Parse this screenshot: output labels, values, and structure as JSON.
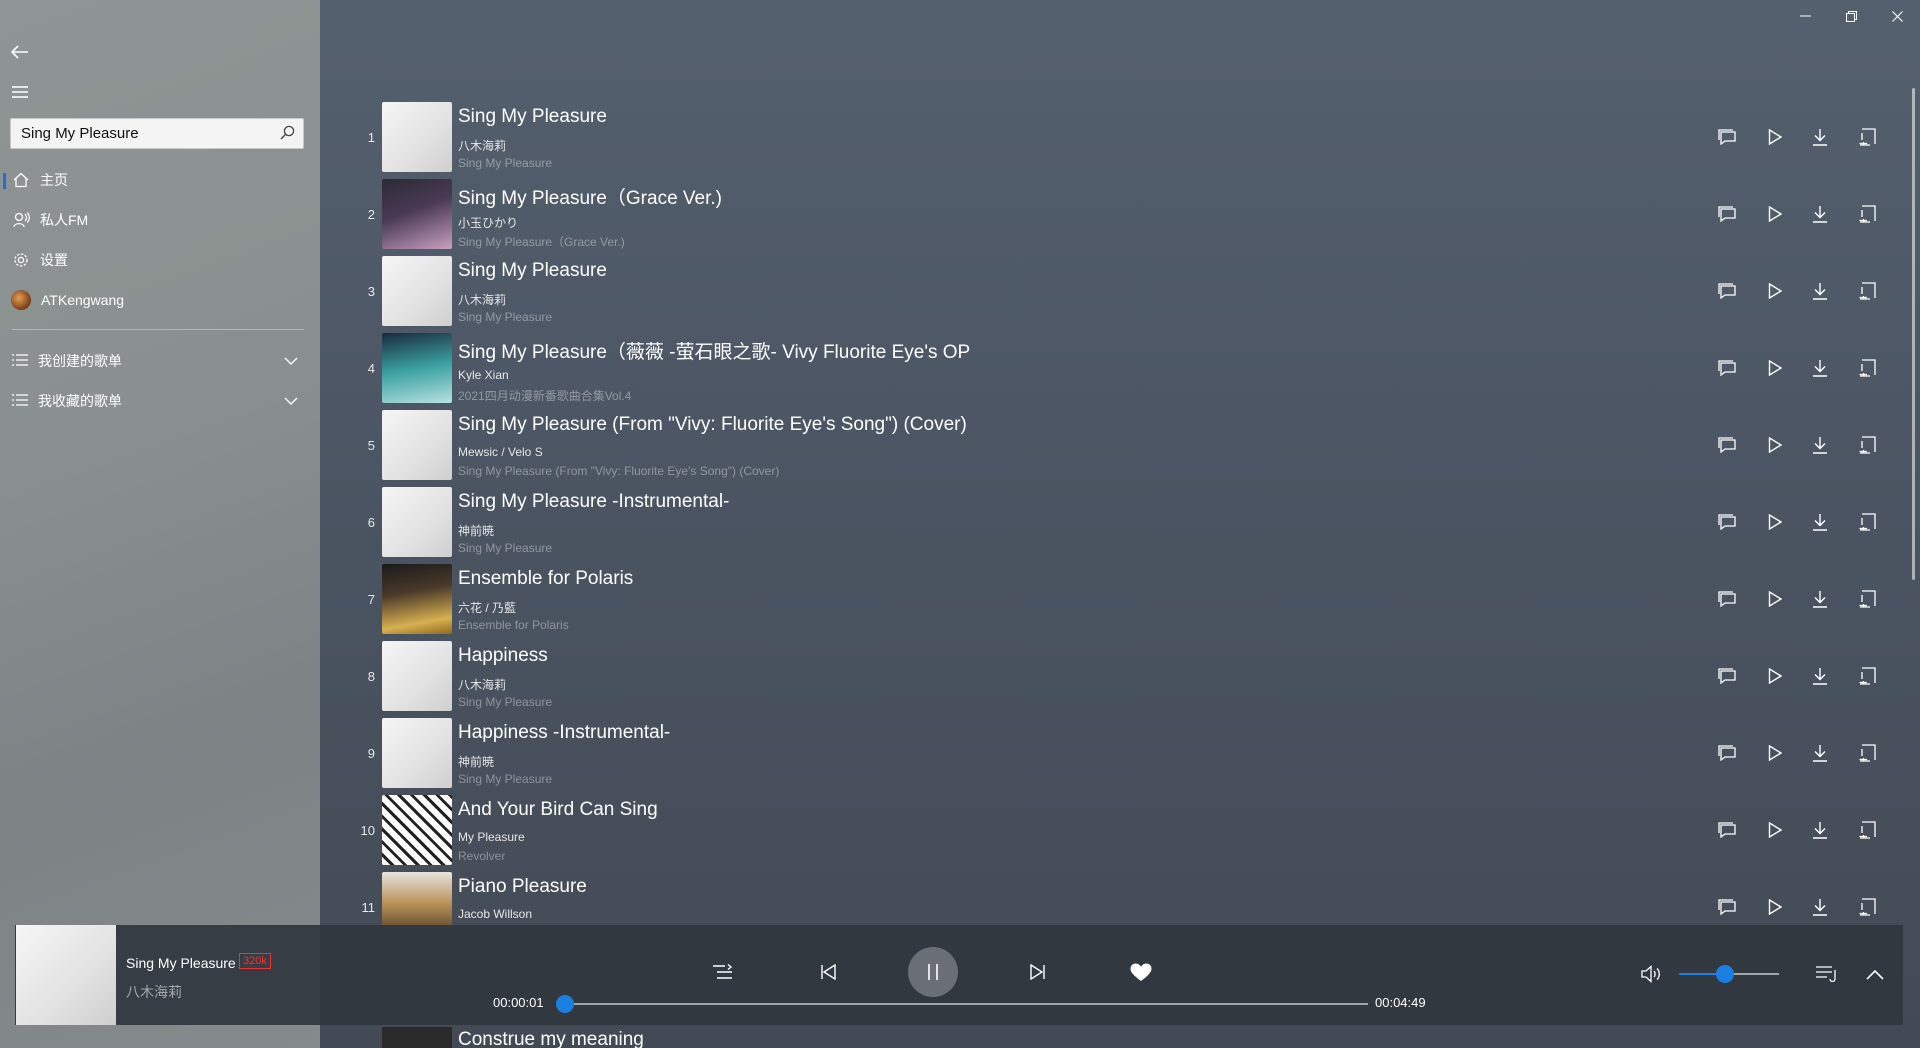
{
  "window": {
    "minimize": "—",
    "restore": "❐",
    "close": "✕"
  },
  "sidebar": {
    "back_icon": "arrow-left-icon",
    "menu_icon": "hamburger-icon",
    "search": {
      "value": "Sing My Pleasure",
      "placeholder": ""
    },
    "items": [
      {
        "label": "主页",
        "icon": "home-icon",
        "selected": true
      },
      {
        "label": "私人FM",
        "icon": "radio-icon",
        "selected": false
      },
      {
        "label": "设置",
        "icon": "gear-icon",
        "selected": false
      },
      {
        "label": "ATKengwang",
        "icon": "avatar",
        "selected": false
      }
    ],
    "groups": [
      {
        "label": "我创建的歌单"
      },
      {
        "label": "我收藏的歌单"
      }
    ]
  },
  "songs": [
    {
      "index": "1",
      "title": "Sing My Pleasure",
      "artist": "八木海莉",
      "album": "Sing My Pleasure",
      "cover": "white"
    },
    {
      "index": "2",
      "title": "Sing My Pleasure（Grace Ver.)",
      "artist": "小玉ひかり",
      "album": "Sing My Pleasure（Grace Ver.)",
      "cover": "dark1"
    },
    {
      "index": "3",
      "title": "Sing My Pleasure",
      "artist": "八木海莉",
      "album": "Sing My Pleasure",
      "cover": "white"
    },
    {
      "index": "4",
      "title": "Sing My Pleasure（薇薇 -萤石眼之歌- Vivy Fluorite Eye's OP",
      "artist": "Kyle Xian",
      "album": "2021四月动漫新番歌曲合集Vol.4",
      "cover": "teal"
    },
    {
      "index": "5",
      "title": "Sing My Pleasure (From \"Vivy: Fluorite Eye's Song\") (Cover)",
      "artist": "Mewsic / Velo S",
      "album": "Sing My Pleasure (From \"Vivy: Fluorite Eye's Song\") (Cover)",
      "cover": "white"
    },
    {
      "index": "6",
      "title": "Sing My Pleasure -Instrumental-",
      "artist": "神前暁",
      "album": "Sing My Pleasure",
      "cover": "white"
    },
    {
      "index": "7",
      "title": "Ensemble for Polaris",
      "artist": "六花 / 乃藍",
      "album": "Ensemble for Polaris",
      "cover": "gold"
    },
    {
      "index": "8",
      "title": "Happiness",
      "artist": "八木海莉",
      "album": "Sing My Pleasure",
      "cover": "white"
    },
    {
      "index": "9",
      "title": "Happiness -Instrumental-",
      "artist": "神前暁",
      "album": "Sing My Pleasure",
      "cover": "white"
    },
    {
      "index": "10",
      "title": "And Your Bird Can Sing",
      "artist": "My Pleasure",
      "album": "Revolver",
      "cover": "bw"
    },
    {
      "index": "11",
      "title": "Piano Pleasure",
      "artist": "Jacob Willson",
      "album": "",
      "cover": "piano"
    }
  ],
  "row_actions": [
    "comment-icon",
    "play-icon",
    "download-icon",
    "add-to-playlist-icon"
  ],
  "peek": {
    "title": "Construe my meaning"
  },
  "player": {
    "title": "Sing My Pleasure",
    "quality": "320k",
    "artist": "八木海莉",
    "elapsed": "00:00:01",
    "duration": "00:04:49",
    "progress_fraction": 0.003,
    "volume_fraction": 0.46,
    "accent": "#1a7fe0",
    "quality_color": "#e33333",
    "liked": true
  }
}
